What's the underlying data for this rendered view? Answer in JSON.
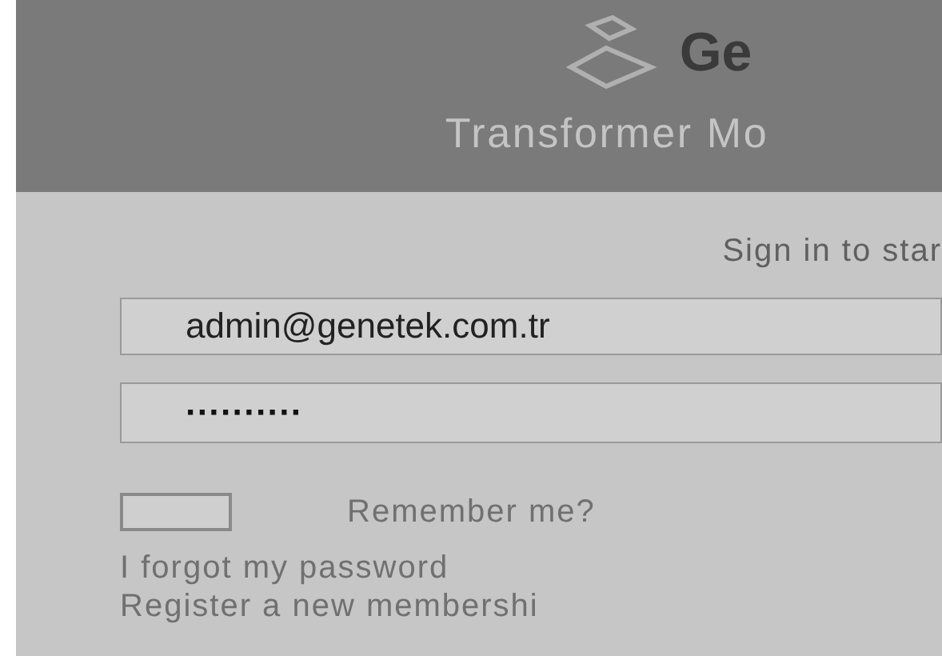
{
  "header": {
    "logo_text": "Ge",
    "subtitle": "Transformer Mo"
  },
  "login": {
    "message": "Sign in to star",
    "email": {
      "value": "admin@genetek.com.tr"
    },
    "password": {
      "value": "··········"
    },
    "remember": {
      "label": "Remember me?",
      "checked": false
    },
    "links": [
      "I forgot my password",
      "Register a new membershi"
    ]
  }
}
